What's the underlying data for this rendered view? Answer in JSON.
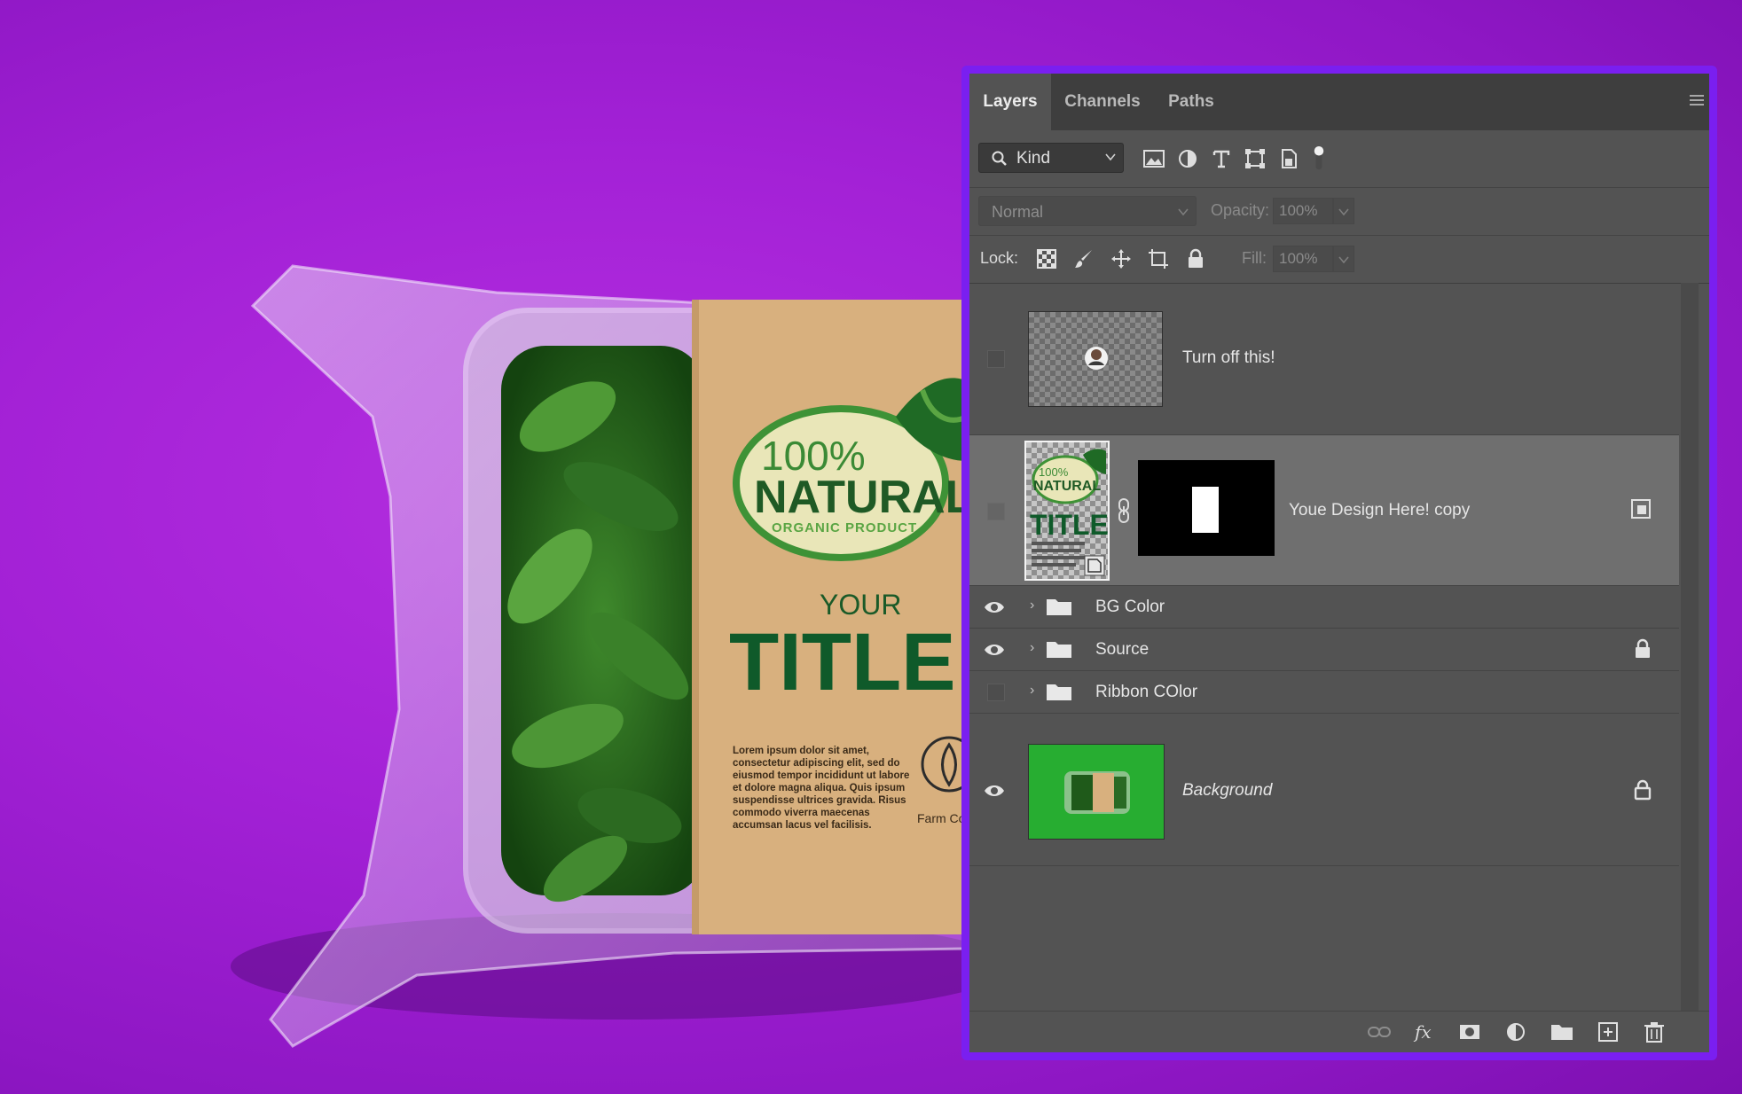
{
  "product_label": {
    "badge_percent": "100%",
    "badge_word": "NATURAL",
    "badge_sub": "ORGANIC PRODUCT",
    "your": "YOUR",
    "title": "TITLE",
    "lorem": [
      "Lorem ipsum dolor sit amet,",
      "consectetur adipiscing elit, sed do",
      "eiusmod tempor incididunt ut labore",
      "et dolore magna aliqua. Quis ipsum",
      "suspendisse ultrices gravida. Risus",
      "commodo viverra maecenas",
      "accumsan lacus vel facilisis."
    ],
    "farm": "Farm Co"
  },
  "panel": {
    "tabs": [
      "Layers",
      "Channels",
      "Paths"
    ],
    "active_tab": "Layers",
    "filter": {
      "kind_label": "Kind"
    },
    "blend_mode": "Normal",
    "opacity_label": "Opacity:",
    "opacity_value": "100%",
    "lock_label": "Lock:",
    "fill_label": "Fill:",
    "fill_value": "100%",
    "layers": [
      {
        "name": "Turn off this!",
        "visible": false,
        "type": "pixel"
      },
      {
        "name": "Youe Design Here! copy",
        "visible": false,
        "type": "smart-object-with-mask",
        "selected": true
      },
      {
        "name": "BG Color",
        "visible": true,
        "type": "group"
      },
      {
        "name": "Source",
        "visible": true,
        "type": "group",
        "locked": true
      },
      {
        "name": "Ribbon COlor",
        "visible": false,
        "type": "group"
      },
      {
        "name": "Background",
        "visible": true,
        "type": "background",
        "locked": true
      }
    ],
    "bottom_icons": [
      "link-layers-icon",
      "fx-icon",
      "add-mask-icon",
      "adjustment-layer-icon",
      "new-group-icon",
      "new-layer-icon",
      "delete-icon"
    ]
  },
  "colors": {
    "background_purple": "#a321d6",
    "panel_border": "#7a1ff0",
    "panel_bg": "#535353",
    "label_kraft": "#d7b07f",
    "title_green": "#0f5a2a"
  }
}
